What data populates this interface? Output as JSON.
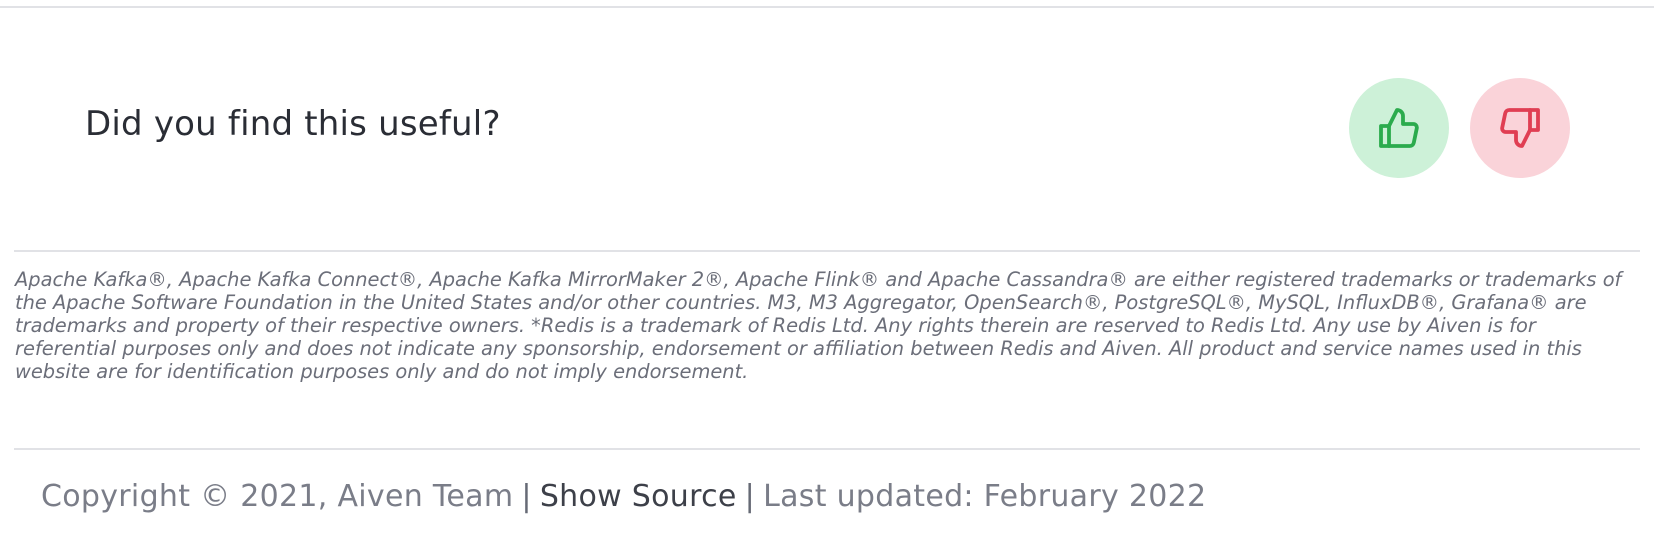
{
  "feedback": {
    "question": "Did you find this useful?",
    "up_icon": "thumbs-up-icon",
    "down_icon": "thumbs-down-icon",
    "up_color": "#2bab4d",
    "up_bg": "#cdf1d8",
    "down_color": "#e03e53",
    "down_bg": "#fad3d9"
  },
  "disclaimer": {
    "text": "Apache Kafka®, Apache Kafka Connect®, Apache Kafka MirrorMaker 2®, Apache Flink® and Apache Cassandra® are either registered trademarks or trademarks of the Apache Software Foundation in the United States and/or other countries. M3, M3 Aggregator, OpenSearch®, PostgreSQL®, MySQL, InfluxDB®, Grafana® are trademarks and property of their respective owners. *Redis is a trademark of Redis Ltd. Any rights therein are reserved to Redis Ltd. Any use by Aiven is for referential purposes only and does not indicate any sponsorship, endorsement or affiliation between Redis and Aiven. All product and service names used in this website are for identification purposes only and do not imply endorsement."
  },
  "footer": {
    "copyright": "Copyright © 2021, Aiven Team",
    "separator": "|",
    "show_source": "Show Source",
    "last_updated": "Last updated: February 2022"
  }
}
